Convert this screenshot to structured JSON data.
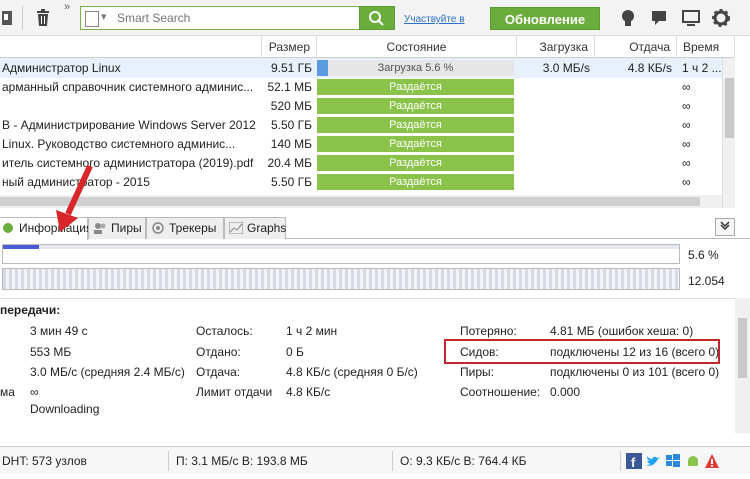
{
  "toolbar": {
    "search_placeholder": "Smart Search",
    "participate_label": "Участвуйте в",
    "update_label": "Обновление"
  },
  "table": {
    "columns": [
      "Размер",
      "Состояние",
      "Загрузка",
      "Отдача",
      "Время"
    ],
    "rows": [
      {
        "name": "Администратор Linux",
        "size": "9.51 ГБ",
        "status": "Загрузка 5.6 %",
        "download": "3.0 МБ/s",
        "upload": "4.8 КБ/s",
        "time": "1 ч 2 ..."
      },
      {
        "name": "арманный справочник системного админис...",
        "size": "52.1 МБ",
        "status": "Раздаётся",
        "download": "",
        "upload": "",
        "time": "∞"
      },
      {
        "name": "",
        "size": "520 МБ",
        "status": "Раздаётся",
        "download": "",
        "upload": "",
        "time": "∞"
      },
      {
        "name": "В - Администрирование Windows Server 2012",
        "size": "5.50 ГБ",
        "status": "Раздаётся",
        "download": "",
        "upload": "",
        "time": "∞"
      },
      {
        "name": "Linux. Руководство системного админис...",
        "size": "140 МБ",
        "status": "Раздаётся",
        "download": "",
        "upload": "",
        "time": "∞"
      },
      {
        "name": "итель системного администратора (2019).pdf",
        "size": "20.4 МБ",
        "status": "Раздаётся",
        "download": "",
        "upload": "",
        "time": "∞"
      },
      {
        "name": "ный администратор - 2015",
        "size": "5.50 ГБ",
        "status": "Раздаётся",
        "download": "",
        "upload": "",
        "time": "∞"
      }
    ],
    "first_row_progress": 0.056
  },
  "tabs": [
    "Информация",
    "Пиры",
    "Трекеры",
    "Graphs"
  ],
  "progress": {
    "downloaded_percent": "5.6 %",
    "availability": "12.054"
  },
  "transfer": {
    "title": "передачи:",
    "col1": [
      {
        "label": "",
        "value": "3 мин 49 с"
      },
      {
        "label": "",
        "value": "553 МБ"
      },
      {
        "label": "",
        "value": "3.0 МБ/с (средняя 2.4 МБ/с)"
      },
      {
        "label": "ма",
        "value": "∞"
      },
      {
        "label": "",
        "value": "Downloading"
      }
    ],
    "col2": [
      {
        "label": "Осталось:",
        "value": "1 ч 2 мин"
      },
      {
        "label": "Отдано:",
        "value": "0 Б"
      },
      {
        "label": "Отдача:",
        "value": "4.8 КБ/с (средняя 0 Б/с)"
      },
      {
        "label": "Лимит отдачи",
        "value": "4.8 КБ/с"
      }
    ],
    "col3": [
      {
        "label": "Потеряно:",
        "value": "4.81 МБ (ошибок хеша: 0)"
      },
      {
        "label": "Сидов:",
        "value": "подключены 12 из 16 (всего 0)"
      },
      {
        "label": "Пиры:",
        "value": "подключены 0 из 101 (всего 0)"
      },
      {
        "label": "Соотношение:",
        "value": "0.000"
      }
    ]
  },
  "statusbar": {
    "dht": "DHT: 573 узлов",
    "down": "П: 3.1 МБ/с В: 193.8 МБ",
    "up": "О: 9.3 КБ/с В: 764.4 КБ"
  },
  "colors": {
    "accent_green": "#6aad3d",
    "seed_green": "#8bc34a",
    "highlight_red": "#c0282b",
    "arrow_red": "#d9262b"
  }
}
